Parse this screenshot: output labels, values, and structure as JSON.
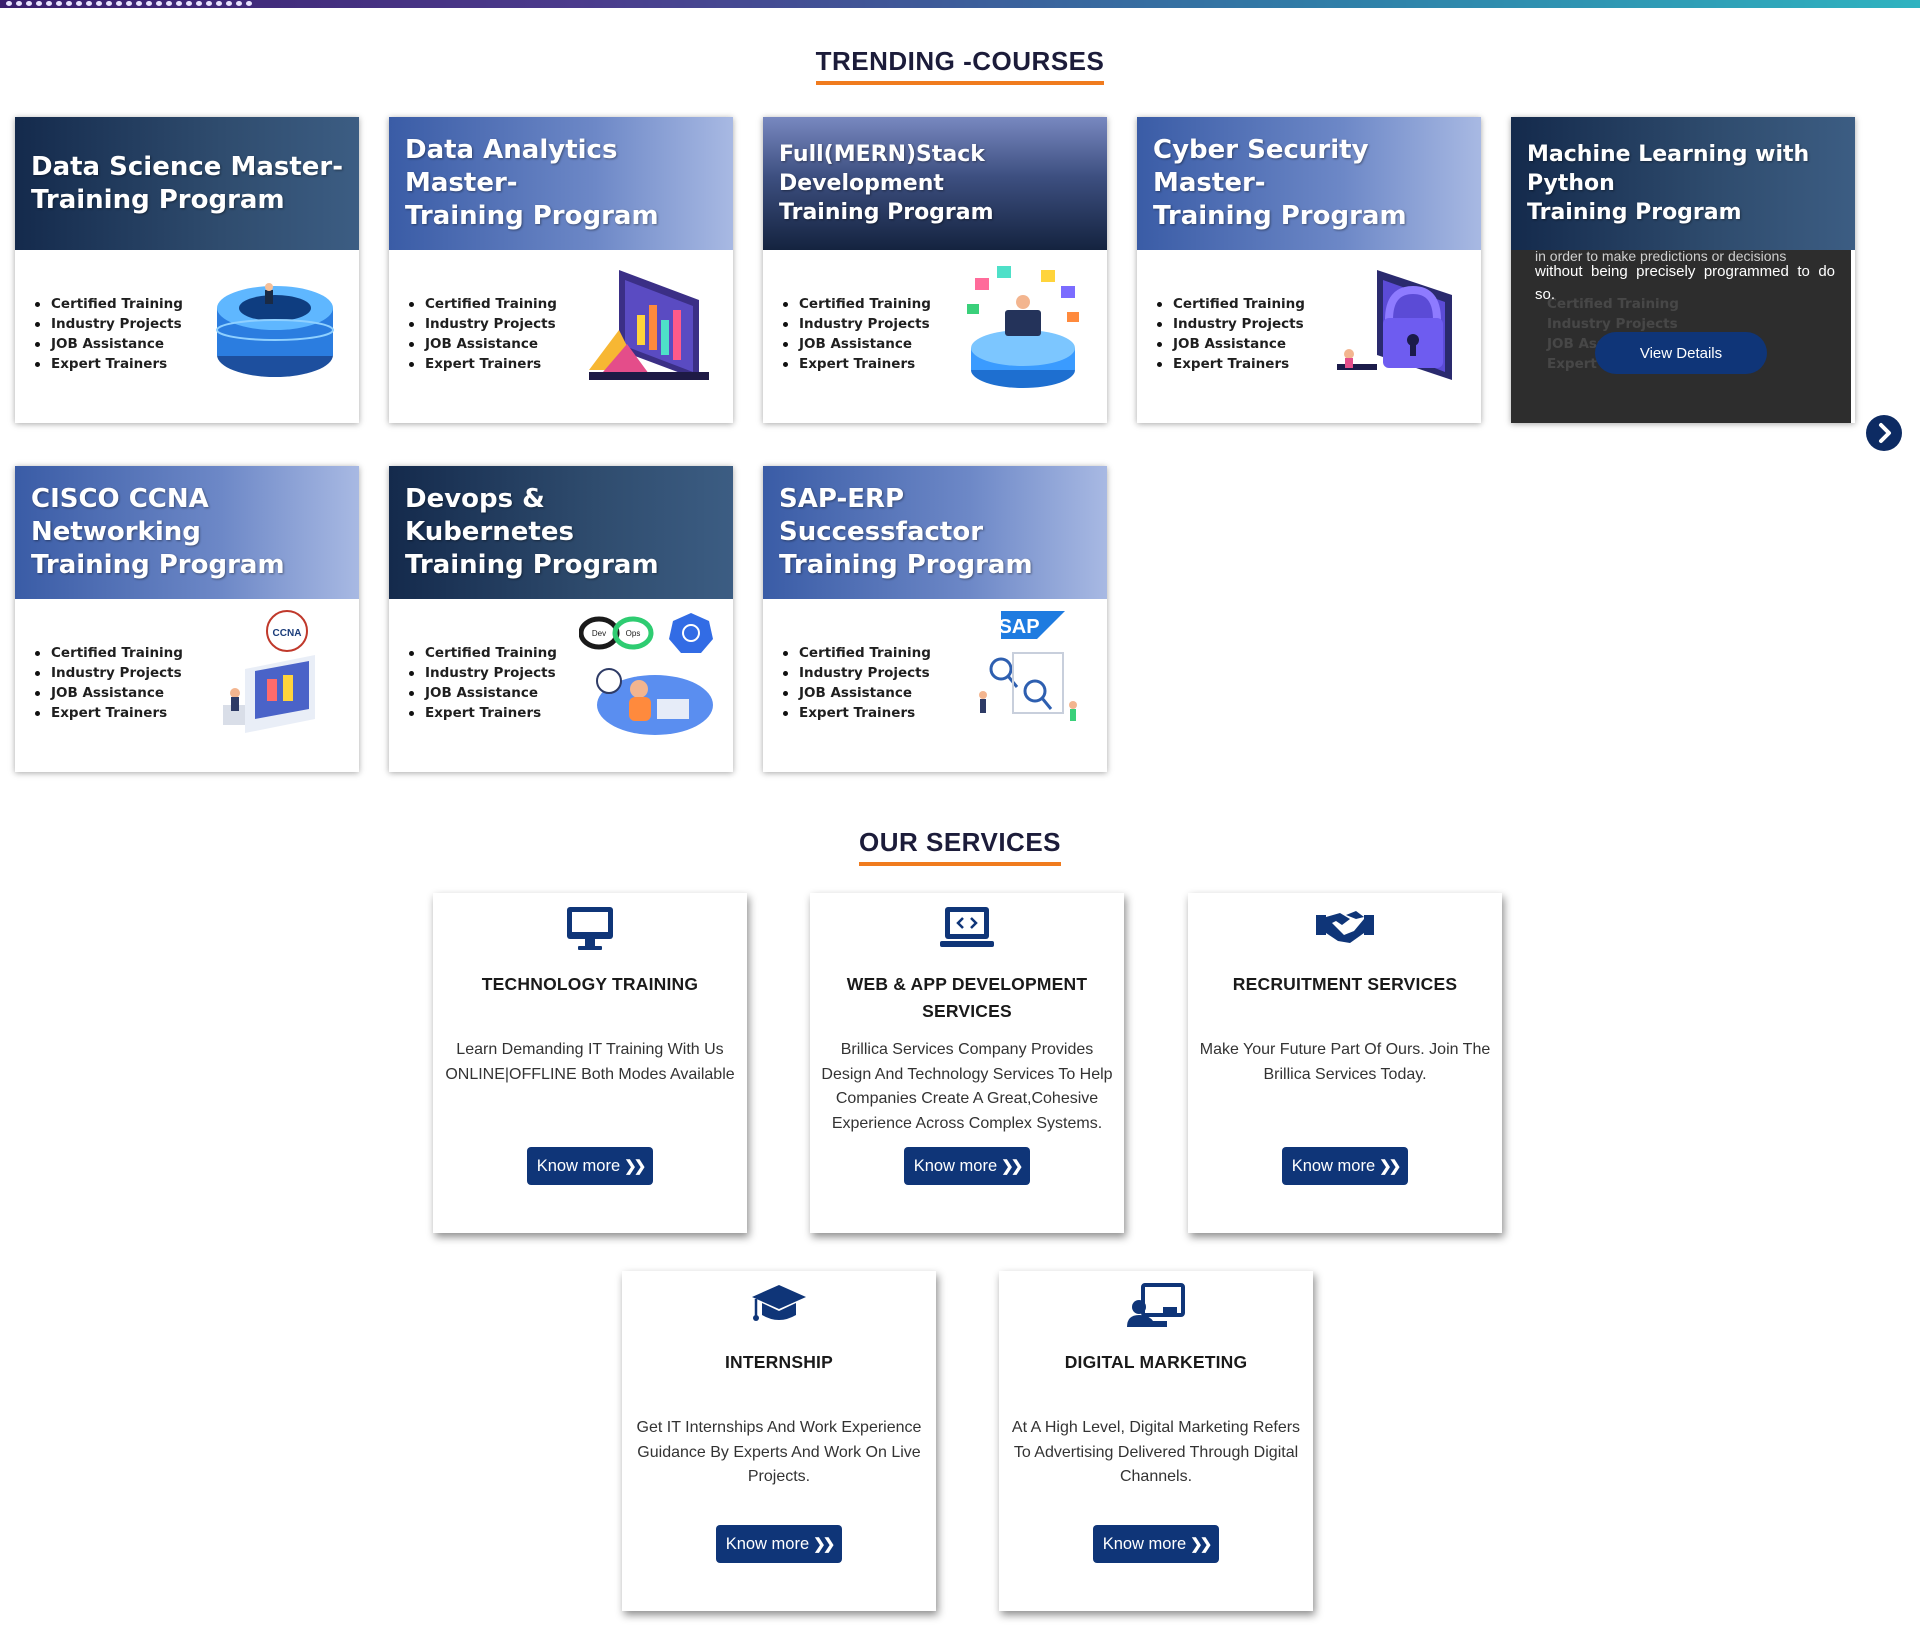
{
  "sections": {
    "courses_title": "TRENDING -COURSES",
    "services_title": "OUR SERVICES"
  },
  "courses": [
    {
      "title": "Data Science Master-\nTraining Program",
      "illustration": "data-science-illustration",
      "features": [
        "Certified Training",
        "Industry Projects",
        "JOB Assistance",
        "Expert Trainers"
      ]
    },
    {
      "title": "Data Analytics Master-\nTraining Program",
      "illustration": "data-analytics-illustration",
      "features": [
        "Certified Training",
        "Industry Projects",
        "JOB Assistance",
        "Expert Trainers"
      ]
    },
    {
      "title": "Full(MERN)Stack Development\nTraining Program",
      "illustration": "full-stack-illustration",
      "features": [
        "Certified Training",
        "Industry Projects",
        "JOB Assistance",
        "Expert Trainers"
      ]
    },
    {
      "title": "Cyber Security Master-\nTraining Program",
      "illustration": "cyber-security-illustration",
      "features": [
        "Certified Training",
        "Industry Projects",
        "JOB Assistance",
        "Expert Trainers"
      ]
    },
    {
      "title": "Machine Learning with Python\nTraining Program",
      "cut_text": "in order to make predictions or decisions",
      "description": "without being precisely programmed to do so.",
      "button": "View Details",
      "features": [
        "Certified Training",
        "Industry Projects",
        "JOB Assistance",
        "Expert Trainers"
      ]
    },
    {
      "title": "CISCO CCNA Networking\nTraining Program",
      "illustration": "ccna-illustration",
      "badge": "CCNA",
      "features": [
        "Certified Training",
        "Industry Projects",
        "JOB Assistance",
        "Expert Trainers"
      ]
    },
    {
      "title": "Devops & Kubernetes\nTraining Program",
      "illustration": "devops-illustration",
      "badge_dev": "Dev",
      "badge_ops": "Ops",
      "features": [
        "Certified Training",
        "Industry Projects",
        "JOB Assistance",
        "Expert Trainers"
      ]
    },
    {
      "title": "SAP-ERP Successfactor\nTraining Program",
      "illustration": "sap-illustration",
      "badge": "SAP",
      "features": [
        "Certified Training",
        "Industry Projects",
        "JOB Assistance",
        "Expert Trainers"
      ]
    }
  ],
  "carousel": {
    "next_icon": "chevron-right-icon"
  },
  "services": [
    {
      "icon": "monitor-icon",
      "title": "TECHNOLOGY TRAINING",
      "description": "Learn Demanding IT Training With Us ONLINE|OFFLINE Both Modes Available",
      "button": "Know more"
    },
    {
      "icon": "laptop-code-icon",
      "title": "WEB & APP DEVELOPMENT SERVICES",
      "description": "Brillica Services Company Provides Design And Technology Services To Help Companies Create A Great,Cohesive Experience Across Complex Systems.",
      "button": "Know more"
    },
    {
      "icon": "handshake-icon",
      "title": "RECRUITMENT SERVICES",
      "description": "Make Your Future Part Of Ours. Join The Brillica Services Today.",
      "button": "Know more"
    },
    {
      "icon": "graduation-cap-icon",
      "title": "INTERNSHIP",
      "description": "Get IT Internships And Work Experience Guidance By Experts And Work On Live Projects.",
      "button": "Know more"
    },
    {
      "icon": "presentation-icon",
      "title": "DIGITAL MARKETING",
      "description": "At A High Level, Digital Marketing Refers To Advertising Delivered Through Digital Channels.",
      "button": "Know more"
    }
  ],
  "colors": {
    "navy": "#0f3578",
    "accent_underline": "#f07b1e"
  }
}
